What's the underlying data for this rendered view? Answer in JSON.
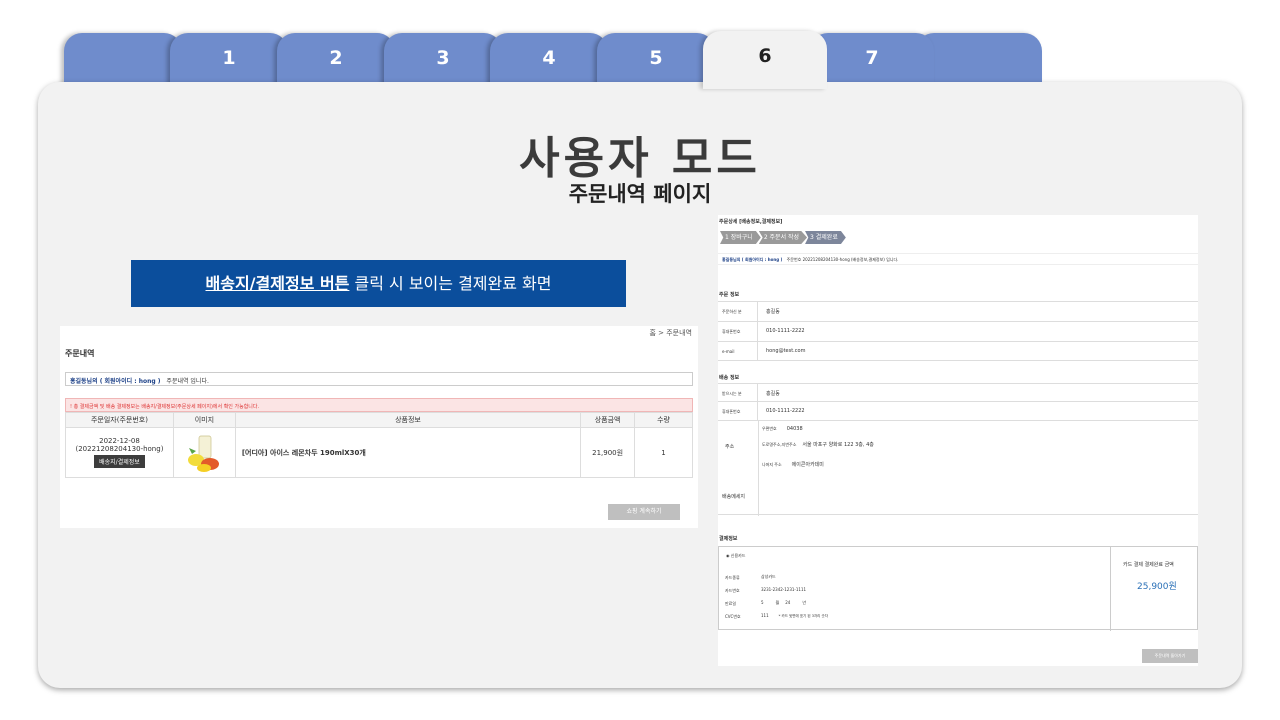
{
  "tabs": [
    {
      "label": ""
    },
    {
      "label": "1"
    },
    {
      "label": "2"
    },
    {
      "label": "3"
    },
    {
      "label": "4"
    },
    {
      "label": "5"
    },
    {
      "label": "6"
    },
    {
      "label": "7"
    },
    {
      "label": ""
    }
  ],
  "slide": {
    "title": "사용자 모드",
    "subtitle": "주문내역 페이지",
    "callout_bold": "배송지/결제정보 버튼",
    "callout_rest": " 클릭 시 보이는 결제완료 화면"
  },
  "order_page": {
    "breadcrumb": "홈 > 주문내역",
    "title": "주문내역",
    "greeting_name": "홍길동님의 ( 회원아이디 : hong )",
    "greeting_rest": "주문내역 입니다.",
    "warning": "! 총 결제금액 및 배송 결제정보는 배송지/결제정보(주문상세 페이지)에서 확인 가능합니다.",
    "columns": [
      "주문일자(주문번호)",
      "이미지",
      "상품정보",
      "상품금액",
      "수량"
    ],
    "row": {
      "date": "2022-12-08",
      "order_no": "(20221208204130-hong)",
      "button": "배송지/결제정보",
      "product": "[어디아] 아이스 레몬차두 190mlX30개",
      "price": "21,900원",
      "qty": "1"
    },
    "shop_button": "쇼핑 계속하기"
  },
  "detail_page": {
    "title": "주문상세 [배송정보,결제정보]",
    "steps": [
      "1 장바구니",
      "2 주문서 작성",
      "3 결제완료"
    ],
    "greeting_name": "홍길동님의 ( 회원아이디 : hong )",
    "greeting_rest": "주문번호 20221208204130-hong (배송정보,결제정보) 입니다.",
    "order_section": "주문 정보",
    "orderer_label": "주문하신 분",
    "orderer_value": "홍길동",
    "phone_label": "휴대폰번호",
    "phone_value": "010-1111-2222",
    "email_label": "e-mail",
    "email_value": "hong@test.com",
    "ship_section": "배송 정보",
    "receiver_label": "받으시는 분",
    "receiver_value": "홍길동",
    "ship_phone_label": "휴대폰번호",
    "ship_phone_value": "010-1111-2222",
    "addr_label": "주소",
    "zip_label": "우편번호",
    "zip_value": "04038",
    "road_label": "도로명주소,지번주소",
    "road_value": "서울 마포구 양화로 122 3층, 4층",
    "detail_label": "나머지 주소",
    "detail_value": "에이콘아카데미",
    "msg_label": "배송메세지",
    "pay_section": "결제정보",
    "pay_radio": "신용카드",
    "card_type_label": "카드종류",
    "card_type_value": "삼성카드",
    "card_no_label": "카드번호",
    "card_no_value": "3231-2342-1231-1111",
    "expire_label": "만료일",
    "expire_month": "5",
    "expire_month_unit": "월",
    "expire_year": "24",
    "expire_year_unit": "년",
    "cvc_label": "CVC번호",
    "cvc_value": "111",
    "cvc_note": "* 카드 뒷면에 표기 된 3자리 숫자",
    "amount_label": "카드 결제 결제완료 금액",
    "amount_value": "25,900원",
    "list_button": "주문내역 돌아가기"
  }
}
